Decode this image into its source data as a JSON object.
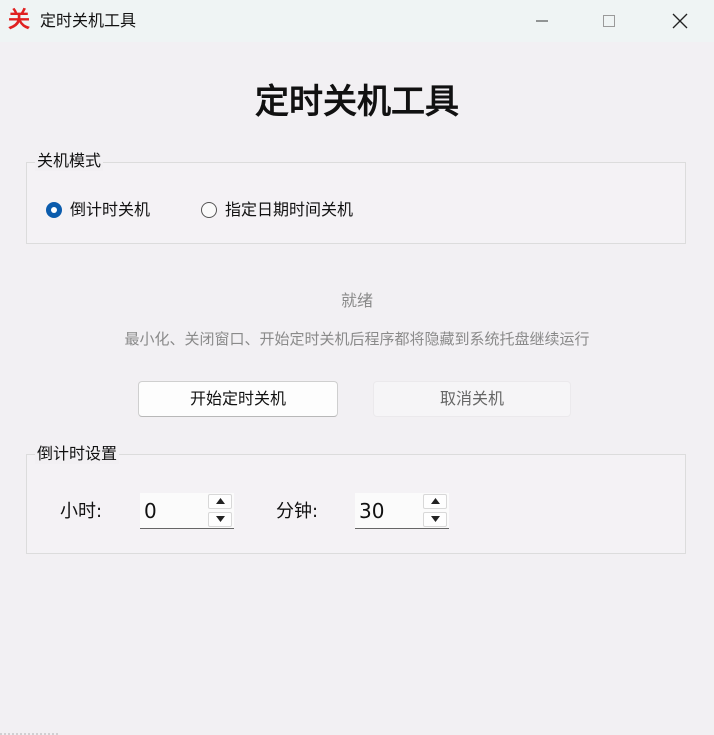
{
  "window": {
    "title": "定时关机工具",
    "icon_char": "关",
    "icon_color": "#e02020"
  },
  "main": {
    "heading": "定时关机工具"
  },
  "mode_group": {
    "title": "关机模式",
    "options": [
      {
        "label": "倒计时关机",
        "selected": true
      },
      {
        "label": "指定日期时间关机",
        "selected": false
      }
    ]
  },
  "status": {
    "text": "就绪",
    "hint": "最小化、关闭窗口、开始定时关机后程序都将隐藏到系统托盘继续运行"
  },
  "actions": {
    "start_label": "开始定时关机",
    "cancel_label": "取消关机"
  },
  "countdown_group": {
    "title": "倒计时设置",
    "hours_label": "小时:",
    "hours_value": "0",
    "minutes_label": "分钟:",
    "minutes_value": "30"
  },
  "colors": {
    "accent": "#0b5cad",
    "muted_text": "#8a8a8a"
  }
}
